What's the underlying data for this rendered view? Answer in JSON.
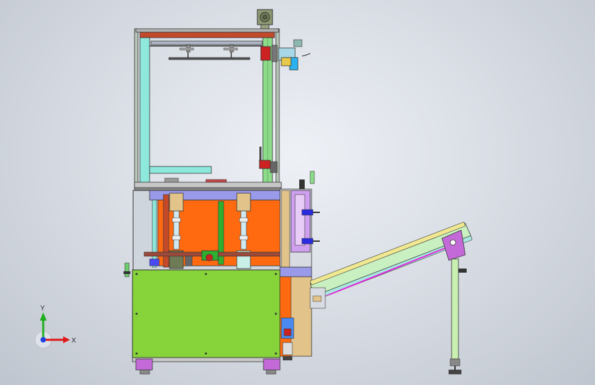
{
  "triad": {
    "x_label": "X",
    "y_label": "Y",
    "x_color": "#e01818",
    "y_color": "#1fae1f",
    "z_color": "#1f3fe0"
  },
  "colors": {
    "frame": "#333333",
    "lower_cabinet": "#86d43a",
    "orange_panel": "#ff6a10",
    "column_green": "#8ddc8a",
    "column_cyan": "#8ee8dc",
    "top_bar": "#c24a2a",
    "conveyor": "#c9f0c0",
    "conveyor_accent": "#e02ad8",
    "violet_panel": "#cfa0f0",
    "tan_block": "#e2c38a"
  }
}
